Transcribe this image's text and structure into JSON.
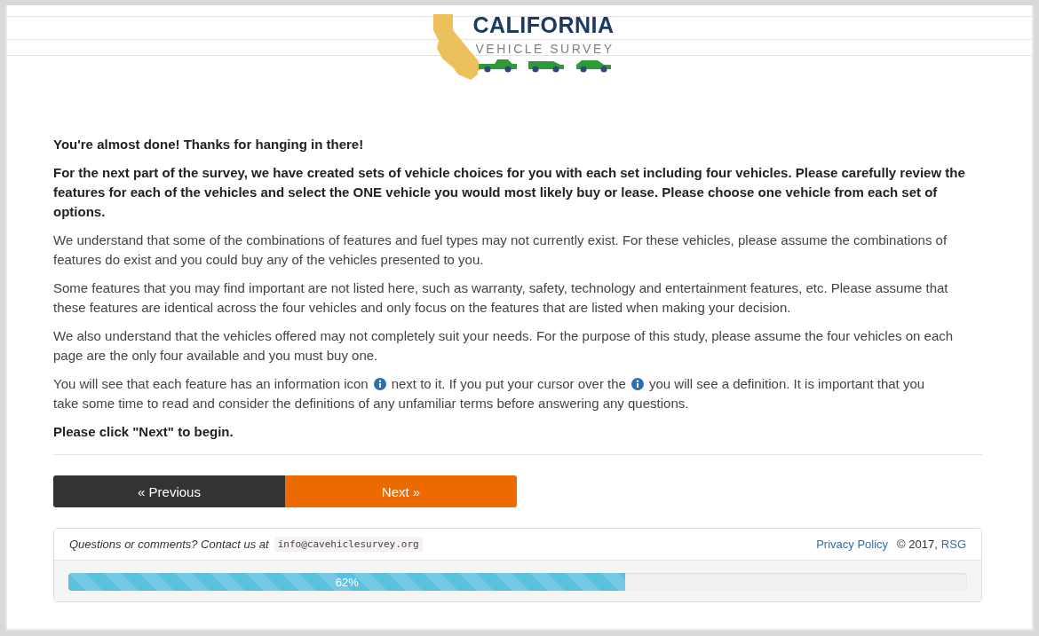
{
  "logo": {
    "title": "CALIFORNIA",
    "subtitle": "VEHICLE SURVEY"
  },
  "intro": [
    {
      "kind": "bold",
      "text": "You're almost done! Thanks for hanging in there!"
    },
    {
      "kind": "bold",
      "text": "For the next part of the survey, we have created sets of vehicle choices for you with each set including four vehicles. Please carefully review the features for each of the vehicles and select the ONE vehicle you would most likely buy or lease. Please choose one vehicle from each set of options."
    },
    {
      "kind": "normal",
      "text": "We understand that some of the combinations of features and fuel types may not currently exist. For these vehicles, please assume the combinations of features do exist and you could buy any of the vehicles presented to you."
    },
    {
      "kind": "normal",
      "text": "Some features that you may find important are not listed here, such as warranty, safety, technology and entertainment features, etc. Please assume that these features are identical across the four vehicles and only focus on the features that are listed when making your decision."
    },
    {
      "kind": "normal",
      "text": "We also understand that the vehicles offered may not completely suit your needs. For the purpose of this study, please assume the four vehicles on each page are the only four available and you must buy one."
    },
    {
      "kind": "info",
      "parts": [
        "You will see that each feature has an information icon",
        "next to it. If you put your cursor over the",
        "you will see a definition. It is important that you"
      ],
      "continuation": "take some time to read and consider the definitions of any unfamiliar terms before answering any questions."
    },
    {
      "kind": "bold",
      "text": "Please click \"Next\" to begin."
    }
  ],
  "buttons": {
    "previous": "« Previous",
    "next": "Next »"
  },
  "footer": {
    "contact": "Questions or comments? Contact us at",
    "email": "info@cavehiclesurvey.org",
    "privacy": "Privacy Policy",
    "copyright": "© 2017,",
    "company": "RSG"
  },
  "progress": {
    "level": 0.62,
    "label": "62%"
  }
}
